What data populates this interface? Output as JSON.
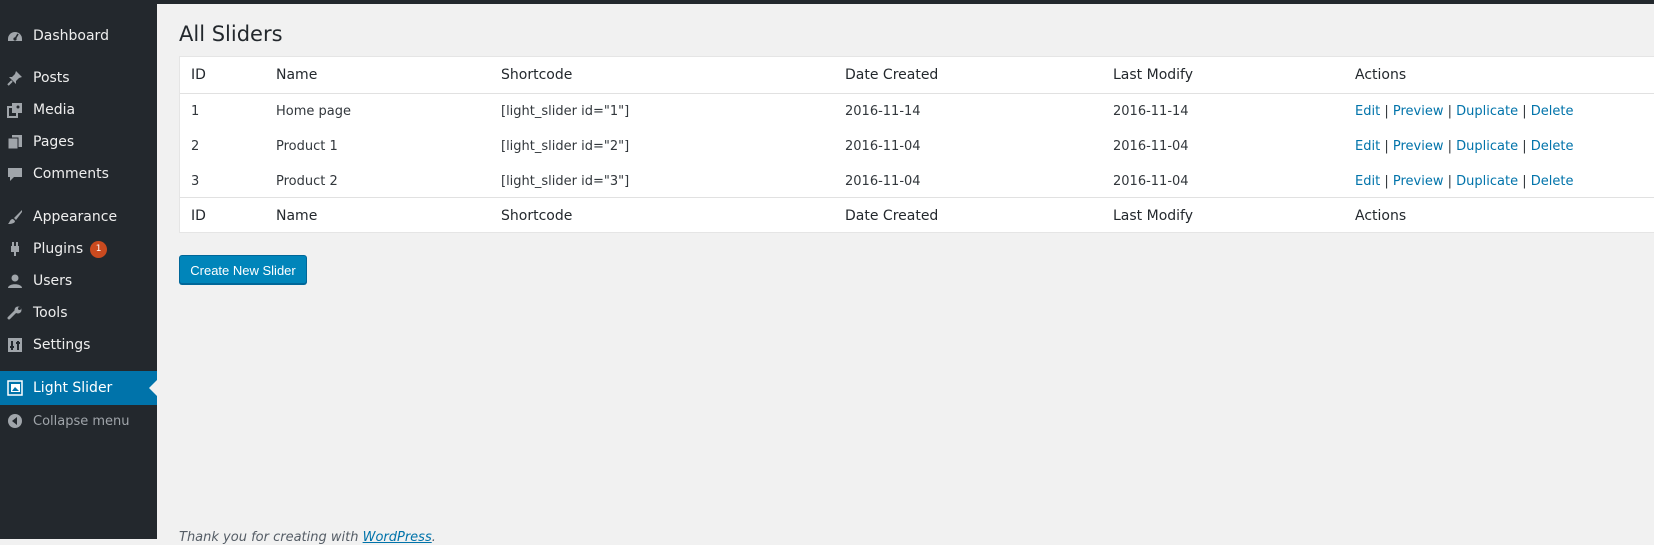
{
  "sidebar": {
    "items": [
      {
        "label": "Dashboard",
        "icon": "dashboard-icon"
      },
      {
        "label": "Posts",
        "icon": "pushpin-icon"
      },
      {
        "label": "Media",
        "icon": "media-icon"
      },
      {
        "label": "Pages",
        "icon": "pages-icon"
      },
      {
        "label": "Comments",
        "icon": "comment-icon"
      },
      {
        "label": "Appearance",
        "icon": "paintbrush-icon"
      },
      {
        "label": "Plugins",
        "icon": "plugin-icon",
        "badge": "1"
      },
      {
        "label": "Users",
        "icon": "user-icon"
      },
      {
        "label": "Tools",
        "icon": "wrench-icon"
      },
      {
        "label": "Settings",
        "icon": "settings-icon"
      },
      {
        "label": "Light Slider",
        "icon": "slider-icon",
        "active": true
      }
    ],
    "collapse_label": "Collapse menu"
  },
  "main": {
    "title": "All Sliders",
    "columns": [
      "ID",
      "Name",
      "Shortcode",
      "Date Created",
      "Last Modify",
      "Actions"
    ],
    "rows": [
      {
        "id": "1",
        "name": "Home page",
        "shortcode": "[light_slider id=\"1\"]",
        "created": "2016-11-14",
        "modified": "2016-11-14"
      },
      {
        "id": "2",
        "name": "Product 1",
        "shortcode": "[light_slider id=\"2\"]",
        "created": "2016-11-04",
        "modified": "2016-11-04"
      },
      {
        "id": "3",
        "name": "Product 2",
        "shortcode": "[light_slider id=\"3\"]",
        "created": "2016-11-04",
        "modified": "2016-11-04"
      }
    ],
    "actions": {
      "edit": "Edit",
      "preview": "Preview",
      "duplicate": "Duplicate",
      "delete": "Delete",
      "separator": "|"
    },
    "create_button": "Create New Slider"
  },
  "footer": {
    "text": "Thank you for creating with",
    "link": "WordPress",
    "suffix": "."
  },
  "colors": {
    "sidebar": "#23282d",
    "accent": "#0073aa",
    "button": "#0085ba",
    "badge": "#ca4a1f",
    "background": "#f1f1f1"
  }
}
